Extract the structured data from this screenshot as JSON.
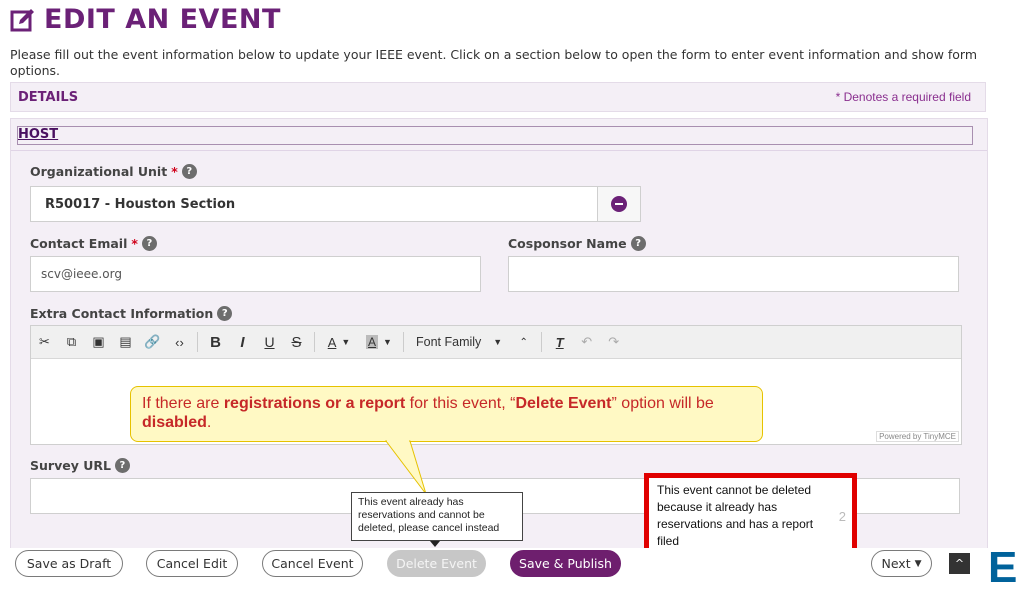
{
  "page": {
    "title": "EDIT AN EVENT",
    "intro": "Please fill out the event information below to update your IEEE event. Click on a section below to open the form to enter event information and show form options."
  },
  "sections": {
    "details_label": "DETAILS",
    "required_note": "* Denotes a required field",
    "host_label": "HOST"
  },
  "form": {
    "org_unit": {
      "label": "Organizational Unit",
      "star": "*",
      "value": "R50017 - Houston Section"
    },
    "contact_email": {
      "label": "Contact Email",
      "star": "*",
      "value": "scv@ieee.org"
    },
    "cosponsor": {
      "label": "Cosponsor Name",
      "value": ""
    },
    "extra_contact": {
      "label": "Extra Contact Information"
    },
    "survey_url": {
      "label": "Survey URL",
      "value": ""
    },
    "help_glyph": "?"
  },
  "editor": {
    "font_family": "Font Family",
    "powered_by": "Powered by TinyMCE",
    "bold": "B",
    "italic": "I",
    "underline": "U",
    "strike": "S",
    "font_color": "A",
    "bg_color": "A"
  },
  "callout": {
    "p1": "If there are ",
    "p2": "registrations or a report",
    "p3": " for this event, “",
    "p4": "Delete Event",
    "p5": "” option will be ",
    "p6": "disabled",
    "p7": "."
  },
  "tooltip": "This event already has reservations and cannot be deleted, please cancel instead",
  "red_note": "This event cannot be deleted because it already has reservations and has a report filed",
  "red_note_side": "2",
  "buttons": {
    "save_draft": "Save as Draft",
    "cancel_edit": "Cancel Edit",
    "cancel_event": "Cancel Event",
    "delete_event": "Delete Event",
    "save_publish": "Save & Publish",
    "next": "Next",
    "top": "^"
  },
  "colors": {
    "brand_purple": "#6b2177",
    "publish": "#6e1f6e",
    "disabled": "#c7c7c7",
    "alert_red": "#e00000"
  }
}
